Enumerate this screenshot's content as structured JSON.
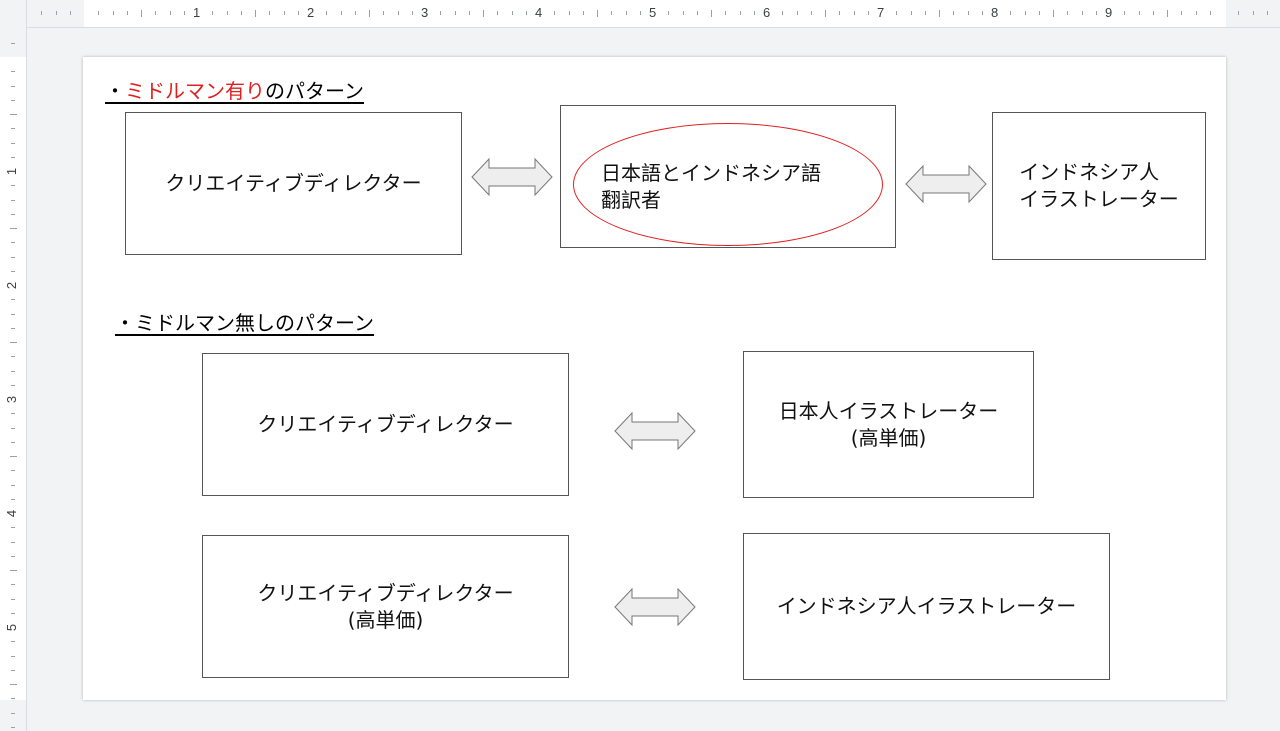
{
  "ruler": {
    "horizontal_numbers": [
      "1",
      "2",
      "3",
      "4",
      "5",
      "6",
      "7",
      "8",
      "9"
    ],
    "vertical_numbers": [
      "1",
      "2",
      "3",
      "4",
      "5"
    ]
  },
  "slide": {
    "section1": {
      "heading_prefix": "・",
      "heading_red": "ミドルマン有り",
      "heading_rest": "のパターン",
      "box_left": "クリエイティブディレクター",
      "box_middle_line1": "日本語とインドネシア語",
      "box_middle_line2": "翻訳者",
      "box_right_line1": "インドネシア人",
      "box_right_line2": "イラストレーター"
    },
    "section2": {
      "heading": "・ミドルマン無しのパターン",
      "row1_left": "クリエイティブディレクター",
      "row1_right_line1": "日本人イラストレーター",
      "row1_right_line2": "(高単価)",
      "row2_left_line1": "クリエイティブディレクター",
      "row2_left_line2": "(高単価)",
      "row2_right": "インドネシア人イラストレーター"
    }
  },
  "colors": {
    "highlight_red": "#e02020",
    "arrow_fill": "#eeeeee",
    "arrow_stroke": "#777777",
    "box_border": "#555555"
  }
}
